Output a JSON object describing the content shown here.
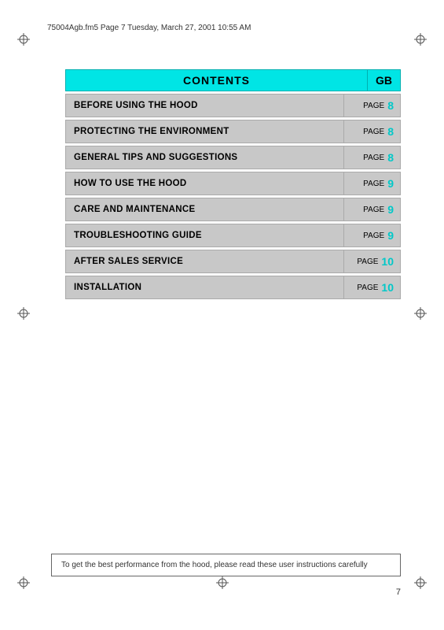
{
  "header": {
    "filename": "75004Agb.fm5  Page 7  Tuesday, March 27, 2001  10:55 AM"
  },
  "contents": {
    "title": "CONTENTS",
    "gb_label": "GB"
  },
  "toc_items": [
    {
      "label": "BEFORE USING THE HOOD",
      "page_word": "PAGE",
      "page_num": "8"
    },
    {
      "label": "PROTECTING THE ENVIRONMENT",
      "page_word": "PAGE",
      "page_num": "8"
    },
    {
      "label": "GENERAL TIPS AND SUGGESTIONS",
      "page_word": "PAGE",
      "page_num": "8"
    },
    {
      "label": "HOW TO USE THE HOOD",
      "page_word": "PAGE",
      "page_num": "9"
    },
    {
      "label": "CARE AND MAINTENANCE",
      "page_word": "PAGE",
      "page_num": "9"
    },
    {
      "label": "TROUBLESHOOTING GUIDE",
      "page_word": "PAGE",
      "page_num": "9"
    },
    {
      "label": "AFTER SALES SERVICE",
      "page_word": "PAGE",
      "page_num": "10"
    },
    {
      "label": "INSTALLATION",
      "page_word": "PAGE",
      "page_num": "10"
    }
  ],
  "bottom_note": "To get the best performance from the hood, please read these user instructions carefully",
  "page_number": "7"
}
